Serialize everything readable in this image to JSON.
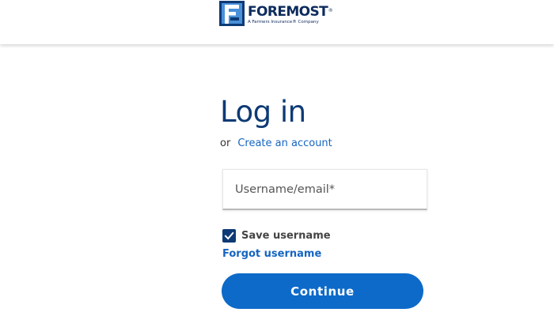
{
  "header": {
    "logo": {
      "icon": "foremost-f-logo-icon",
      "word": "FOREMOST",
      "registered": "®",
      "tagline": "A Farmers Insurance® Company"
    }
  },
  "login": {
    "title": "Log in",
    "or_text": "or",
    "create_account_link": "Create an account",
    "username_placeholder": "Username/email*",
    "username_value": "",
    "save_username_label": "Save username",
    "save_username_checked": true,
    "forgot_username_link": "Forgot username",
    "continue_label": "Continue"
  },
  "colors": {
    "brand_navy": "#0d3a75",
    "link_blue": "#1565c0",
    "button_blue": "#0d6ac9",
    "logo_light_blue": "#4a90d9"
  }
}
